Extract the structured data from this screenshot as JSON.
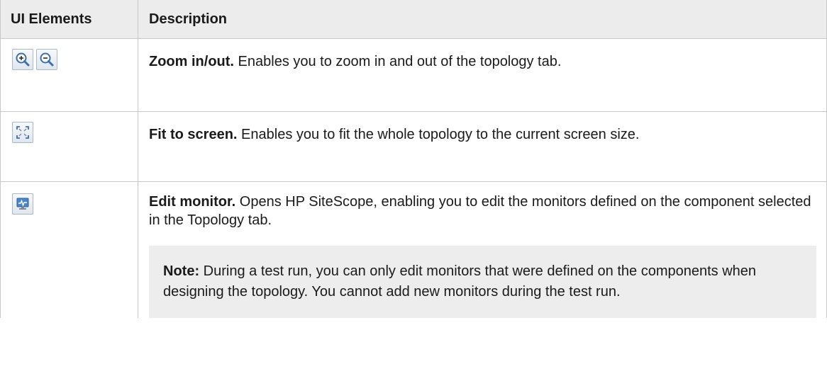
{
  "header": {
    "col1": "UI Elements",
    "col2": "Description"
  },
  "rows": [
    {
      "icons": [
        "zoom-in-icon",
        "zoom-out-icon"
      ],
      "title": "Zoom in/out.",
      "text": "Enables you to zoom in and out of the topology tab."
    },
    {
      "icons": [
        "fit-to-screen-icon"
      ],
      "title": "Fit to screen.",
      "text": "Enables you to fit the whole topology to the current screen size."
    },
    {
      "icons": [
        "edit-monitor-icon"
      ],
      "title": "Edit monitor.",
      "text": "Opens HP SiteScope, enabling you to edit the monitors defined on the component selected in the Topology tab.",
      "note_label": "Note:",
      "note_text": "During a test run, you can only edit monitors that were defined on the components when designing the topology. You cannot add new monitors during the test run."
    }
  ],
  "colors": {
    "header_bg": "#ececec",
    "border": "#c8c8c8",
    "note_bg": "#ededed",
    "icon_blue": "#3b6fb0"
  }
}
